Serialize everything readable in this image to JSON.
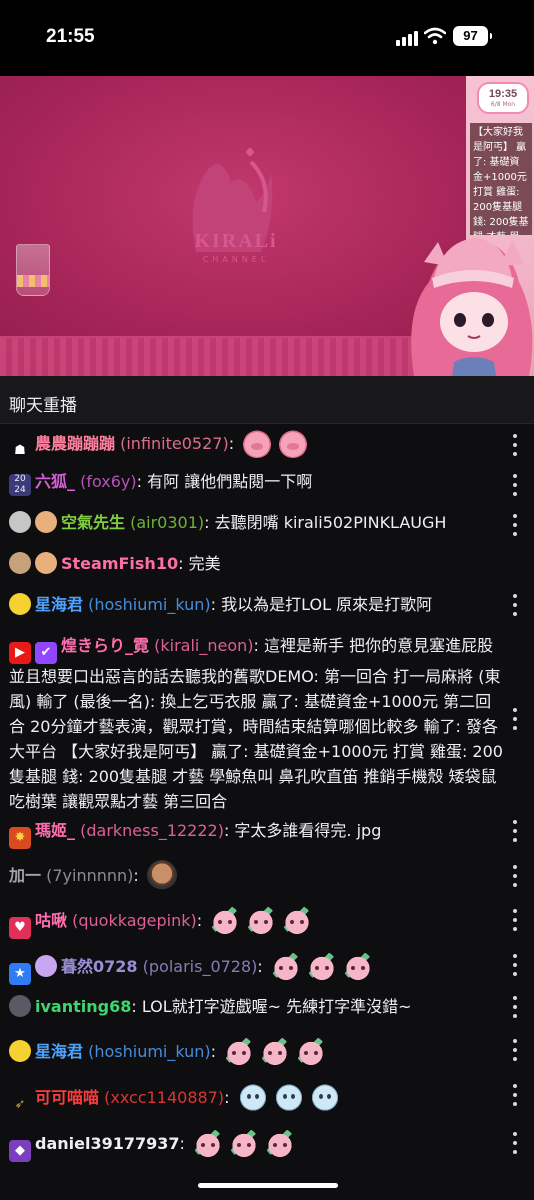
{
  "status_bar": {
    "time": "21:55",
    "battery": "97"
  },
  "video": {
    "logo_text": "KIRALi",
    "logo_sub": "CHANNEL",
    "clock_time": "19:35",
    "clock_date": "6/8 Mon",
    "side_text": "【大家好我是阿丐】 贏了: 基礎資金+1000元 打賞 雞蛋: 200隻基腿 錢: 200隻基腿 才藝 學鯨"
  },
  "chat": {
    "title": "聊天重播",
    "messages": [
      {
        "user": "農農蹦蹦蹦",
        "login": "(infinite0527)",
        "sep": ":",
        "text": "",
        "color": "#ff7f9f"
      },
      {
        "user": "六狐_",
        "login": "(fox6y)",
        "sep": ":",
        "text": " 有阿 讓他們點閱一下啊",
        "color": "#d45fd4"
      },
      {
        "user": "空氣先生",
        "login": "(air0301)",
        "sep": ":",
        "text": " 去聽閉嘴 kirali502PINKLAUGH",
        "color": "#7fcf3f"
      },
      {
        "user": "SteamFish10",
        "login": "",
        "sep": ":",
        "text": " 完美",
        "color": "#ff6fa6"
      },
      {
        "user": "星海君",
        "login": "(hoshiumi_kun)",
        "sep": ":",
        "text": " 我以為是打LOL 原來是打歌阿",
        "color": "#4fa3ff"
      },
      {
        "user": "煌きらり_霓",
        "login": "(kirali_neon)",
        "sep": ":",
        "text": " 這裡是新手 把你的意見塞進屁股 並且想要口出惡言的話去聽我的舊歌DEMO: 第一回合 打一局麻將 (東風) 輸了 (最後一名): 換上乞丐衣服 贏了: 基礎資金+1000元 第二回合 20分鐘才藝表演，觀眾打賞，時間結束結算哪個比較多 輸了: 發各大平台 【大家好我是阿丐】 贏了: 基礎資金+1000元 打賞 雞蛋: 200隻基腿 錢: 200隻基腿 才藝 學鯨魚叫 鼻孔吹直笛 推銷手機殼 矮袋鼠吃樹葉 讓觀眾點才藝 第三回合",
        "color": "#ff6fb0"
      },
      {
        "user": "瑪姬_",
        "login": "(darkness_12222)",
        "sep": ":",
        "text": " 字太多誰看得完. jpg",
        "color": "#ff6fb0"
      },
      {
        "user": "加一",
        "login": "(7yinnnnn)",
        "sep": ":",
        "text": "",
        "color": "#a3a3a8"
      },
      {
        "user": "咕啾",
        "login": "(quokkagepink)",
        "sep": ":",
        "text": "",
        "color": "#ff6fb0"
      },
      {
        "user": "暮然0728",
        "login": "(polaris_0728)",
        "sep": ":",
        "text": "",
        "color": "#9a8fd6"
      },
      {
        "user": "ivanting68",
        "login": "",
        "sep": ":",
        "text": " LOL就打字遊戲喔~ 先練打字準沒錯~",
        "color": "#3fd66f"
      },
      {
        "user": "星海君",
        "login": "(hoshiumi_kun)",
        "sep": ":",
        "text": "",
        "color": "#4fa3ff"
      },
      {
        "user": "可可喵喵",
        "login": "(xxcc1140887)",
        "sep": ":",
        "text": "",
        "color": "#ff3b3b"
      },
      {
        "user": "daniel39177937",
        "login": "",
        "sep": ":",
        "text": "",
        "color": "#efeff1"
      }
    ]
  },
  "colors": {
    "accent": "#a62558",
    "chat_bg": "#0e0e10",
    "header_bg": "#18181b"
  },
  "icons": [
    "more-options-icon",
    "badge-icon",
    "emote-icon"
  ]
}
